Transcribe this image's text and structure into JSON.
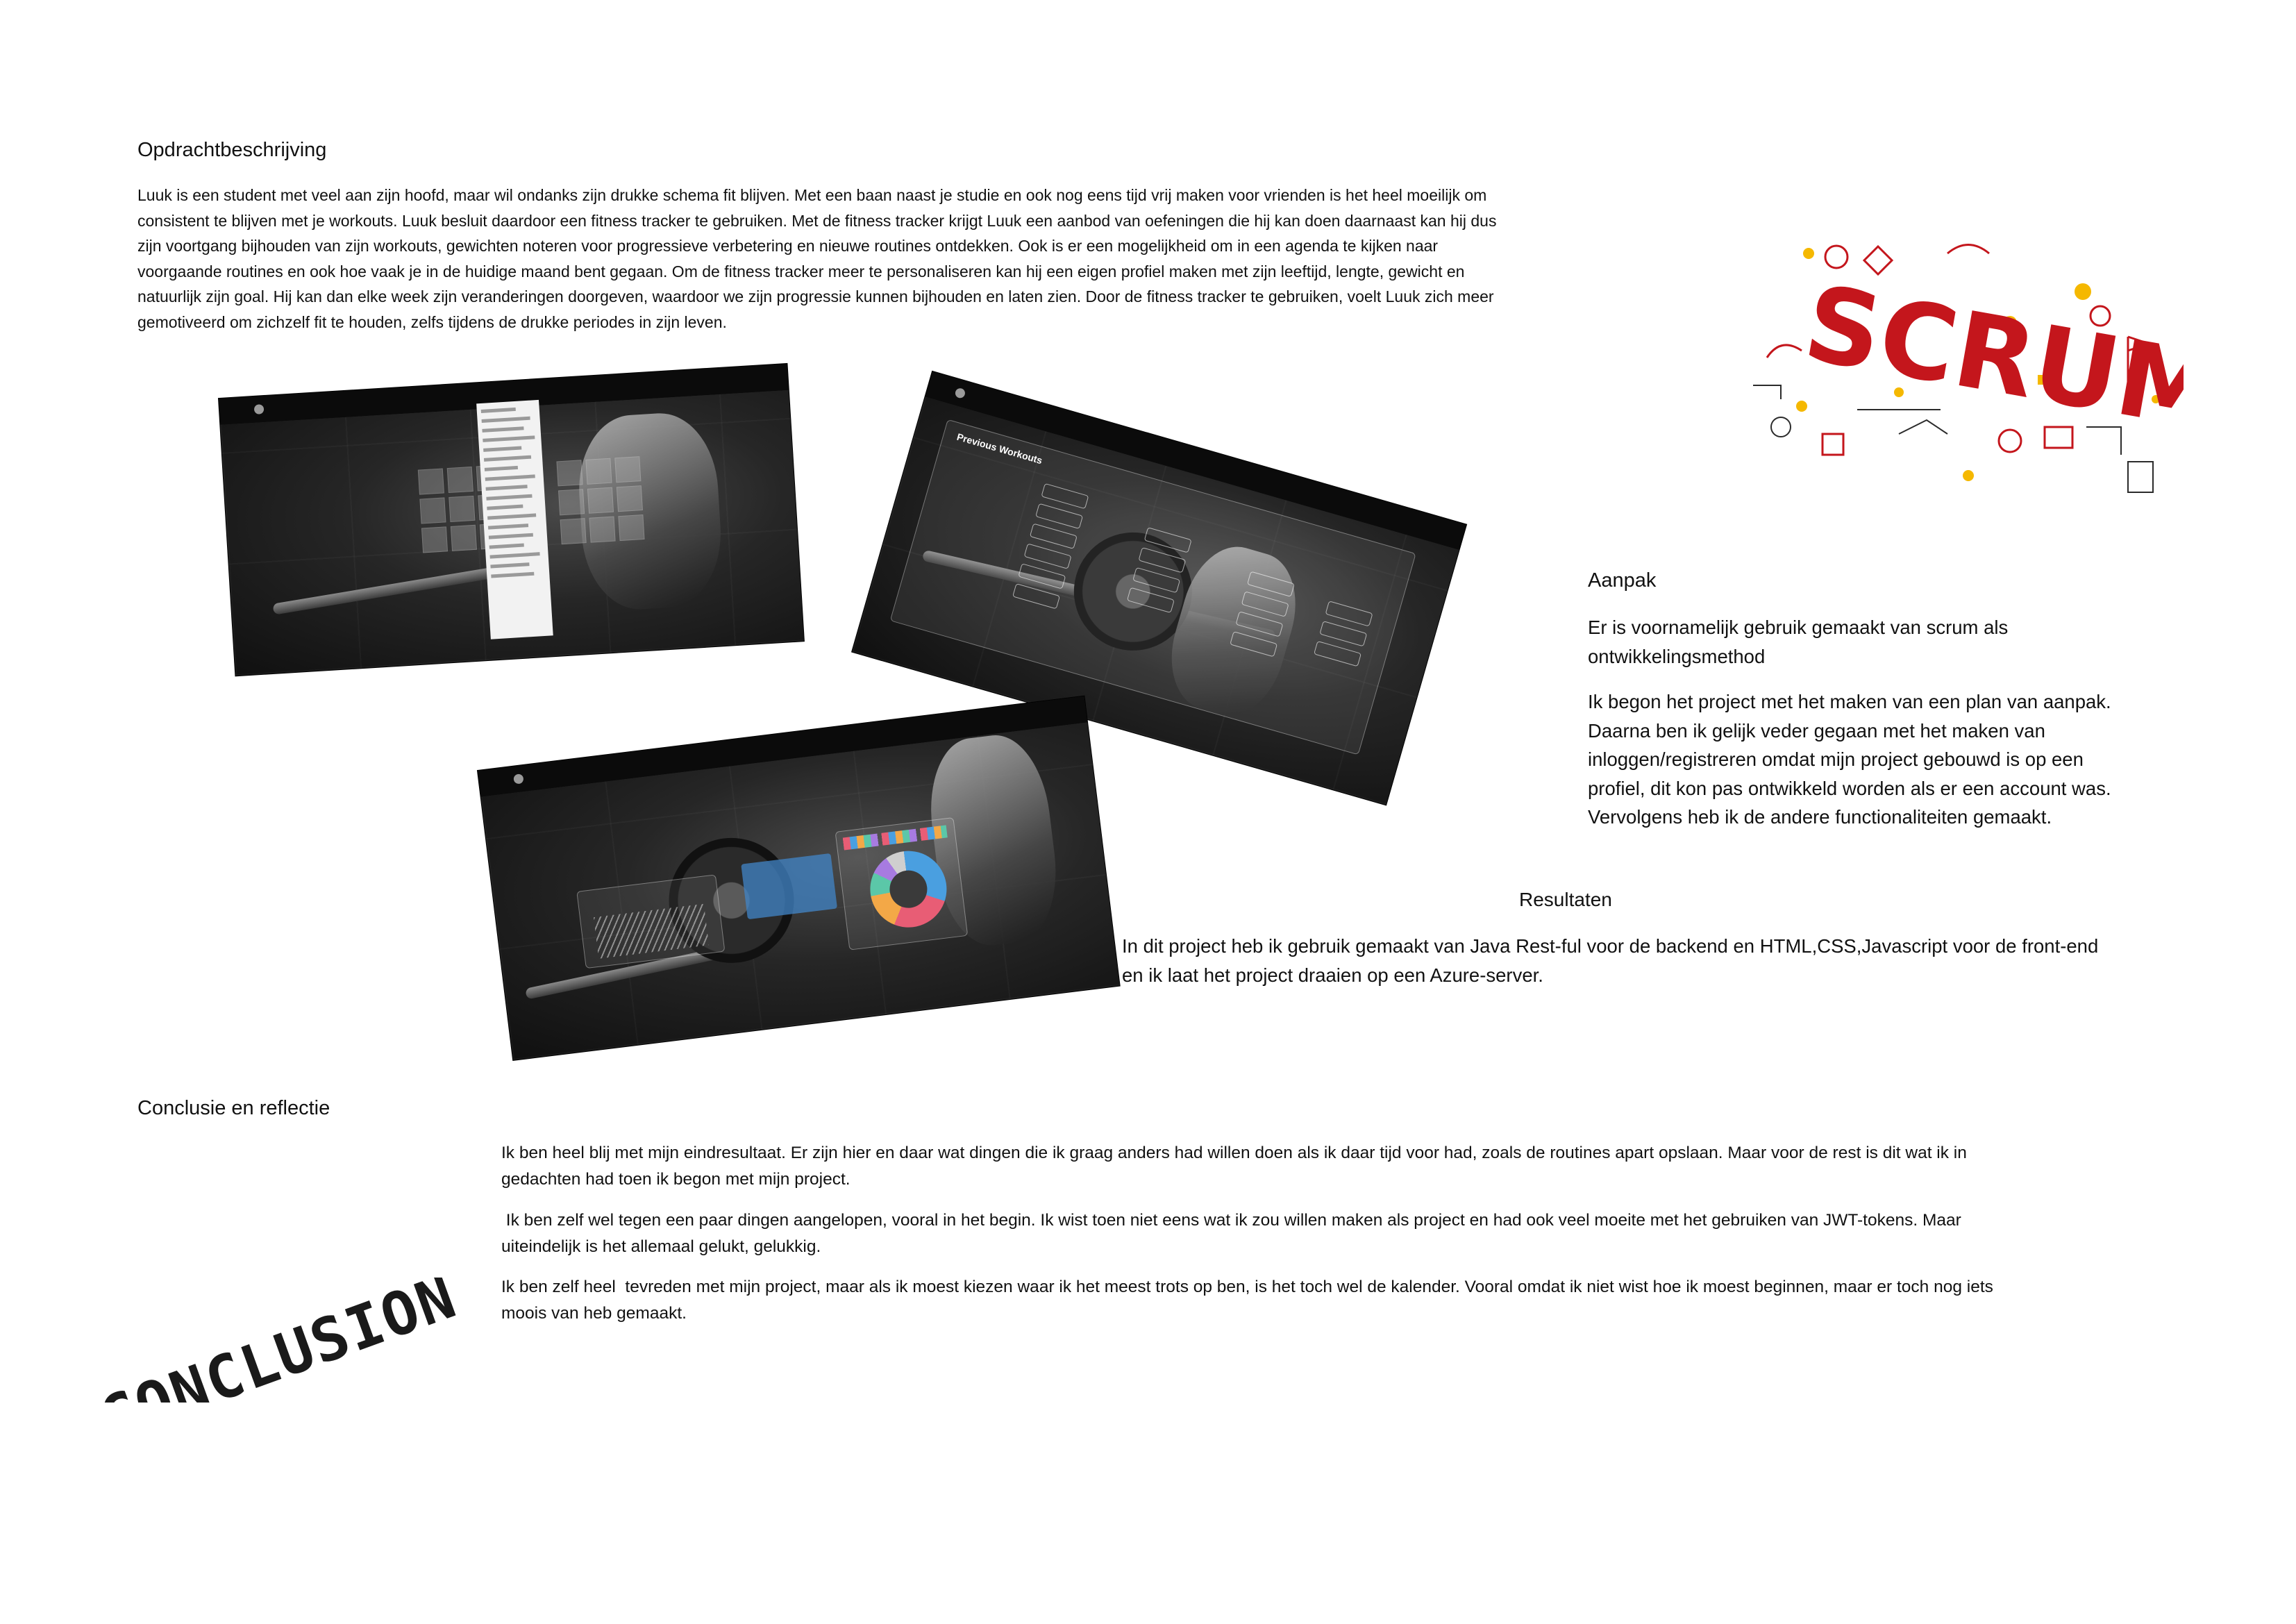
{
  "opdracht": {
    "heading": "Opdrachtbeschrijving",
    "lines": [
      "Luuk is een student met veel aan zijn hoofd, maar wil ondanks zijn drukke schema fit blijven. Met een baan naast je studie en ook nog eens tijd vrij maken voor vrienden is het heel moeilijk om",
      "consistent te blijven met je workouts. Luuk besluit daardoor een fitness tracker te gebruiken. Met de fitness tracker krijgt Luuk een aanbod van oefeningen die hij kan doen daarnaast kan hij dus",
      "zijn voortgang bijhouden van zijn workouts, gewichten noteren voor progressieve verbetering en nieuwe routines ontdekken. Ook is er een mogelijkheid om in een agenda te kijken naar",
      "voorgaande routines en ook hoe vaak je in de huidige maand bent gegaan. Om de fitness tracker meer te personaliseren kan hij een eigen profiel maken met zijn leeftijd, lengte, gewicht en",
      "natuurlijk zijn goal. Hij kan dan elke week zijn veranderingen doorgeven, waardoor we zijn progressie kunnen bijhouden en laten zien. Door de fitness tracker te gebruiken, voelt Luuk zich meer",
      "gemotiveerd om zichzelf fit te houden, zelfs tijdens de drukke periodes in zijn leven."
    ]
  },
  "scrum_logo": {
    "text": "SCRUM",
    "color": "#c4161c",
    "accent": "#f5b800"
  },
  "aanpak": {
    "heading": "Aanpak",
    "para1": [
      "Er is voornamelijk gebruik gemaakt van scrum als",
      "ontwikkelingsmethod"
    ],
    "para2": [
      "Ik begon het project met het maken van een plan van aanpak.",
      "Daarna ben ik gelijk veder gegaan met het maken van",
      "inloggen/registreren omdat mijn project gebouwd is op een",
      "profiel, dit kon pas ontwikkeld worden als er een account was.",
      "Vervolgens heb ik de andere functionaliteiten gemaakt."
    ]
  },
  "resultaten": {
    "heading": "Resultaten",
    "lines": [
      "In dit project heb ik gebruik gemaakt van Java Rest-ful voor de backend en HTML,CSS,Javascript voor de front-end",
      "en ik laat het project draaien op een Azure-server."
    ]
  },
  "conclusie": {
    "heading": "Conclusie en reflectie",
    "para1": [
      "Ik ben heel blij met mijn eindresultaat. Er zijn hier en daar wat dingen die ik graag anders had willen doen als ik daar tijd voor had, zoals de routines apart opslaan. Maar voor de rest is dit wat ik in",
      "gedachten had toen ik begon met mijn project."
    ],
    "para2": [
      " Ik ben zelf wel tegen een paar dingen aangelopen, vooral in het begin. Ik wist toen niet eens wat ik zou willen maken als project en had ook veel moeite met het gebruiken van JWT-tokens. Maar",
      "uiteindelijk is het allemaal gelukt, gelukkig."
    ],
    "para3": [
      "Ik ben zelf heel  tevreden met mijn project, maar als ik moest kiezen waar ik het meest trots op ben, is het toch wel de kalender. Vooral omdat ik niet wist hoe ik moest beginnen, maar er toch nog iets",
      "moois van heb gemaakt."
    ]
  },
  "conclusion_stamp": {
    "text": "CONCLUSION"
  },
  "screenshots": {
    "workouts_title": "Previous Workouts"
  }
}
